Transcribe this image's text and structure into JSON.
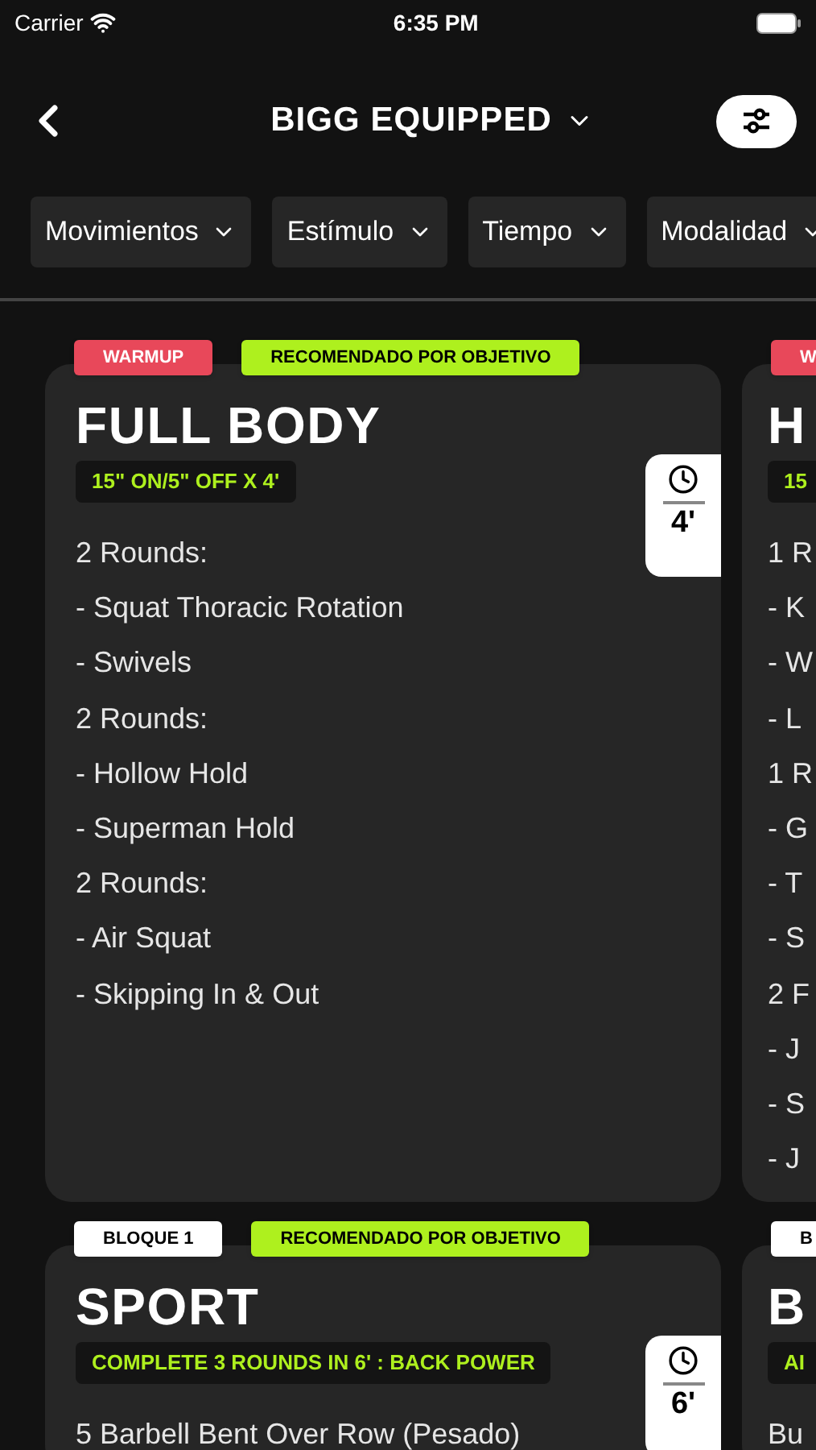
{
  "status_bar": {
    "carrier": "Carrier",
    "time": "6:35 PM"
  },
  "header": {
    "title": "BIGG EQUIPPED"
  },
  "filters": [
    {
      "label": "Movimientos"
    },
    {
      "label": "Estímulo"
    },
    {
      "label": "Tiempo"
    },
    {
      "label": "Modalidad"
    }
  ],
  "rows": [
    {
      "cards": [
        {
          "badges": [
            {
              "text": "WARMUP",
              "kind": "warmup"
            },
            {
              "text": "RECOMENDADO POR OBJETIVO",
              "kind": "recommended"
            }
          ],
          "title": "FULL BODY",
          "tag": "15\" ON/5\" OFF X 4'",
          "duration": "4'",
          "lines": [
            "2 Rounds:",
            "- Squat Thoracic Rotation",
            "- Swivels",
            "2 Rounds:",
            "- Hollow Hold",
            "- Superman Hold",
            "2 Rounds:",
            "- Air Squat",
            "- Skipping In & Out"
          ]
        },
        {
          "badges": [
            {
              "text": "W",
              "kind": "warmup"
            }
          ],
          "title": "H",
          "tag": "15",
          "lines": [
            "1 R",
            "- K",
            "- W",
            "- L",
            "1 R",
            "- G",
            "- T",
            "- S",
            "2 F",
            "- J",
            "- S",
            "- J"
          ]
        }
      ]
    },
    {
      "cards": [
        {
          "badges": [
            {
              "text": "BLOQUE 1",
              "kind": "block"
            },
            {
              "text": "RECOMENDADO POR OBJETIVO",
              "kind": "recommended"
            }
          ],
          "title": "SPORT",
          "tag": "COMPLETE 3 ROUNDS IN 6' : BACK POWER",
          "duration": "6'",
          "lines": [
            "5 Barbell Bent Over Row (Pesado)"
          ]
        },
        {
          "badges": [
            {
              "text": "B",
              "kind": "block"
            }
          ],
          "title": "B",
          "tag": "AI",
          "lines": [
            "Bu"
          ]
        }
      ]
    }
  ]
}
